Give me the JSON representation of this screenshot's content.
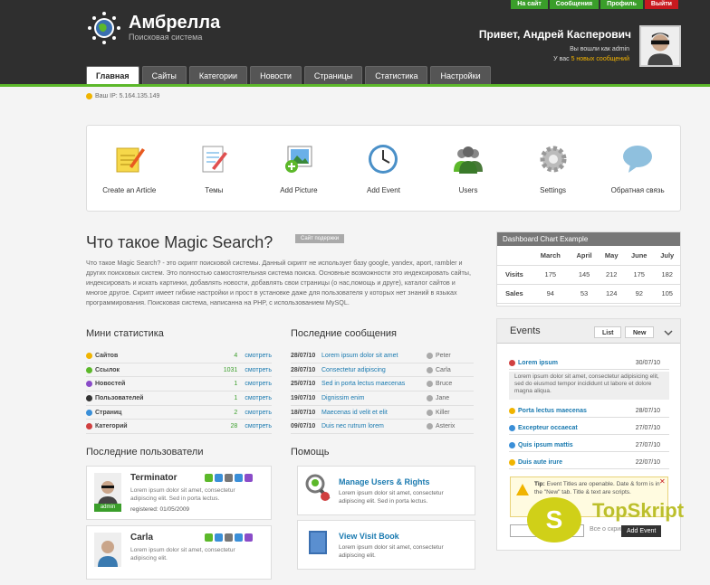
{
  "app": {
    "title": "Амбрелла",
    "subtitle": "Поисковая система"
  },
  "topnav": [
    "На сайт",
    "Сообщения",
    "Профиль",
    "Выйти"
  ],
  "user": {
    "greeting": "Привет, Андрей Касперович",
    "logged_as": "Вы вошли как admin",
    "messages_prefix": "У вас",
    "messages_link": "5 новых сообщений"
  },
  "tabs": [
    "Главная",
    "Сайты",
    "Категории",
    "Новости",
    "Страницы",
    "Статистика",
    "Настройки"
  ],
  "ip": "Ваш IP: 5.164.135.149",
  "shortcuts": [
    "Create an Article",
    "Темы",
    "Add Picture",
    "Add Event",
    "Users",
    "Settings",
    "Обратная связь"
  ],
  "intro": {
    "title": "Что такое Magic Search?",
    "support_btn": "Сайт подержки",
    "text": "Что такое Magic Search? - это скрипт поисковой системы. Данный скрипт не использует базу google, yandex, aport, rambler и других поисковых систем. Это полностью самостоятельная система поиска. Основные возможности это индексировать сайты, индексировать и искать картинки, добавлять новости, добавлять свои страницы (о нас,помощь и друге), каталог сайтов и многое другое. Скрипт имеет гибкие настройки и прост в установке даже для пользователя у которых нет знаний в языках программирования. Поисковая система, написанна на PHP, с использованием MySQL."
  },
  "stats": {
    "title": "Мини статистика",
    "rows": [
      {
        "label": "Сайтов",
        "count": "4",
        "link": "смотреть",
        "color": "#f0b400"
      },
      {
        "label": "Ссылок",
        "count": "1031",
        "link": "смотреть",
        "color": "#5cb82a"
      },
      {
        "label": "Новостей",
        "count": "1",
        "link": "смотреть",
        "color": "#8a4cc8"
      },
      {
        "label": "Пользователей",
        "count": "1",
        "link": "смотреть",
        "color": "#333333"
      },
      {
        "label": "Страниц",
        "count": "2",
        "link": "смотреть",
        "color": "#3a8fd8"
      },
      {
        "label": "Категорий",
        "count": "28",
        "link": "смотреть",
        "color": "#d04040"
      }
    ]
  },
  "messages": {
    "title": "Последние сообщения",
    "rows": [
      {
        "date": "28/07/10",
        "text": "Lorem ipsum dolor sit amet",
        "user": "Peter"
      },
      {
        "date": "28/07/10",
        "text": "Consectetur adipiscing",
        "user": "Carla"
      },
      {
        "date": "25/07/10",
        "text": "Sed in porta lectus maecenas",
        "user": "Bruce"
      },
      {
        "date": "19/07/10",
        "text": "Dignissim enim",
        "user": "Jane"
      },
      {
        "date": "18/07/10",
        "text": "Maecenas id velit et elit",
        "user": "Killer"
      },
      {
        "date": "09/07/10",
        "text": "Duis nec rutrum lorem",
        "user": "Asterix"
      }
    ]
  },
  "users": {
    "title": "Последние пользователи",
    "items": [
      {
        "name": "Terminator",
        "bio": "Lorem ipsum dolor sit amet, consectetur adipiscing elit. Sed in porta lectus.",
        "registered": "registered: 01/05/2009",
        "badge": "admin"
      },
      {
        "name": "Carla",
        "bio": "Lorem ipsum dolor sit amet, consectetur adipiscing elit.",
        "registered": "",
        "badge": ""
      }
    ]
  },
  "help": {
    "title": "Помощь",
    "items": [
      {
        "title": "Manage Users & Rights",
        "text": "Lorem ipsum dolor sit amet, consectetur adipiscing elit. Sed in porta lectus."
      },
      {
        "title": "View Visit Book",
        "text": "Lorem ipsum dolor sit amet, consectetur adipiscing elit."
      }
    ]
  },
  "chart": {
    "caption": "Dashboard Chart Example",
    "months": [
      "March",
      "April",
      "May",
      "June",
      "July"
    ],
    "rows": [
      {
        "label": "Visits",
        "values": [
          "175",
          "145",
          "212",
          "175",
          "182"
        ]
      },
      {
        "label": "Sales",
        "values": [
          "94",
          "53",
          "124",
          "92",
          "105"
        ]
      }
    ]
  },
  "events": {
    "title": "Events",
    "btn_list": "List",
    "btn_new": "New",
    "items": [
      {
        "name": "Lorem ipsum",
        "date": "30/07/10",
        "color": "#d04040"
      },
      {
        "name": "Porta lectus maecenas",
        "date": "28/07/10",
        "color": "#f0b400"
      },
      {
        "name": "Excepteur occaecat",
        "date": "27/07/10",
        "color": "#3a8fd8"
      },
      {
        "name": "Quis ipsum mattis",
        "date": "27/07/10",
        "color": "#3a8fd8"
      },
      {
        "name": "Duis aute irure",
        "date": "22/07/10",
        "color": "#f0b400"
      }
    ],
    "first_desc": "Lorem ipsum dolor sit amet, consectetur adipisicing elit, sed do eiusmod tempor incididunt ut labore et dolore magna aliqua.",
    "tip": {
      "label": "Tip:",
      "text": "Event Titles are openable. Date & form is in the \"New\" tab. Title & text are scripts."
    },
    "input_hint": "Все о скриптах",
    "add_btn": "Add Event"
  },
  "watermark": "TopSkript"
}
